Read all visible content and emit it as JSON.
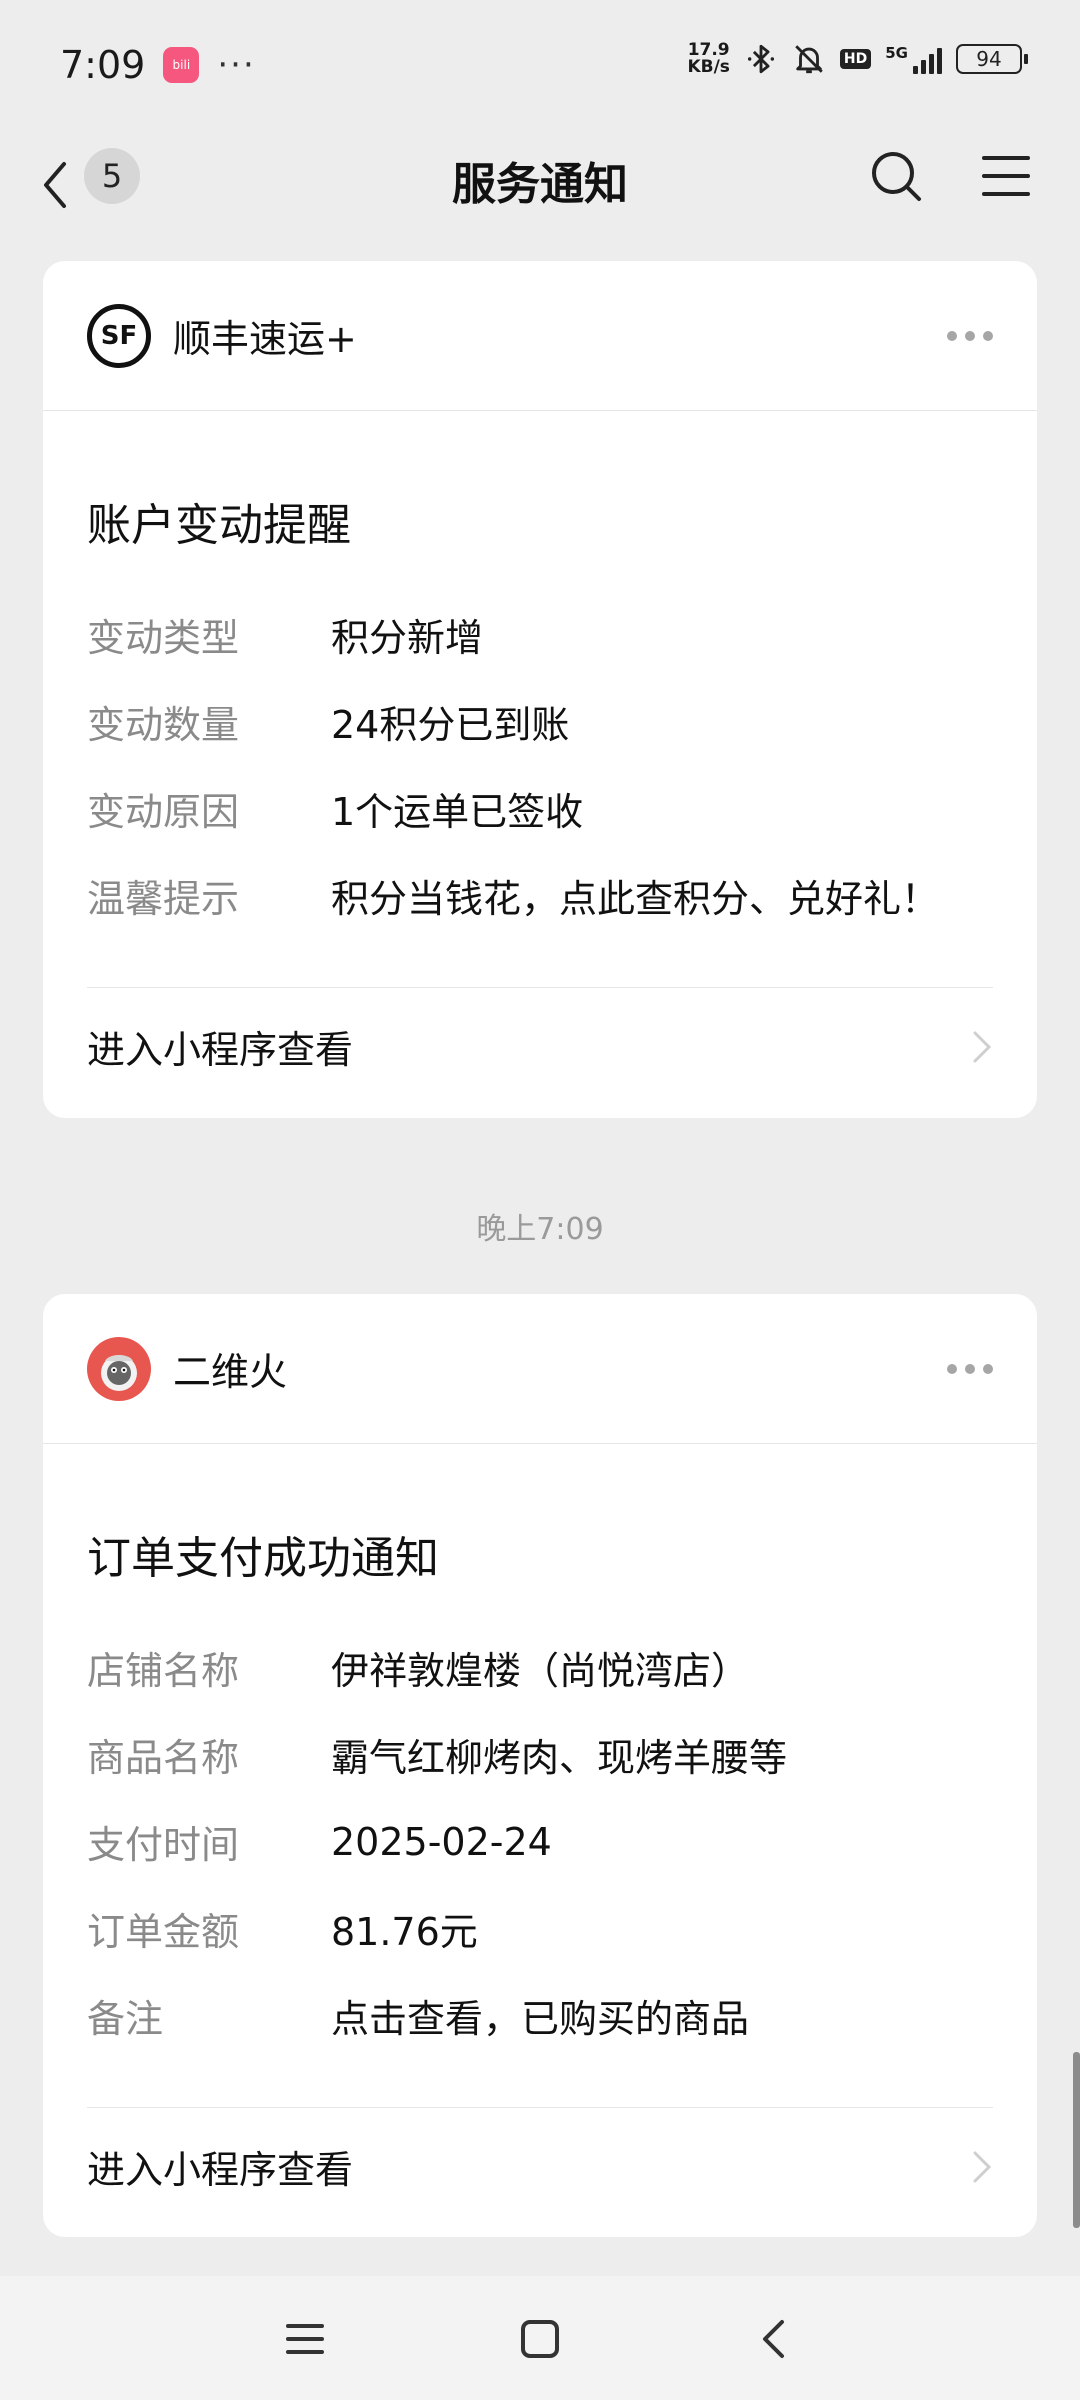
{
  "status_bar": {
    "time": "7:09",
    "app_badge_text": "bili",
    "more": "···",
    "net_speed_value": "17.9",
    "net_speed_unit": "KB/s",
    "hd": "HD",
    "signal": "5G",
    "battery": "94"
  },
  "nav": {
    "unread_count": "5",
    "title": "服务通知"
  },
  "cards": [
    {
      "sender": "顺丰速运+",
      "avatar_text": "SF",
      "title": "账户变动提醒",
      "fields": [
        {
          "label": "变动类型",
          "value": "积分新增"
        },
        {
          "label": "变动数量",
          "value": "24积分已到账"
        },
        {
          "label": "变动原因",
          "value": "1个运单已签收"
        },
        {
          "label": "温馨提示",
          "value": "积分当钱花，点此查积分、兑好礼！"
        }
      ],
      "footer": "进入小程序查看"
    },
    {
      "sender": "二维火",
      "title": "订单支付成功通知",
      "fields": [
        {
          "label": "店铺名称",
          "value": "伊祥敦煌楼（尚悦湾店）"
        },
        {
          "label": "商品名称",
          "value": "霸气红柳烤肉、现烤羊腰等"
        },
        {
          "label": "支付时间",
          "value": "2025-02-24"
        },
        {
          "label": "订单金额",
          "value": "81.76元"
        },
        {
          "label": "备注",
          "value": "点击查看，已购买的商品"
        }
      ],
      "footer": "进入小程序查看"
    }
  ],
  "timestamp": "晚上7:09",
  "colors": {
    "background": "#ededed",
    "card": "#ffffff",
    "label_gray": "#8a8a8a",
    "avatar_red": "#e8574f"
  }
}
